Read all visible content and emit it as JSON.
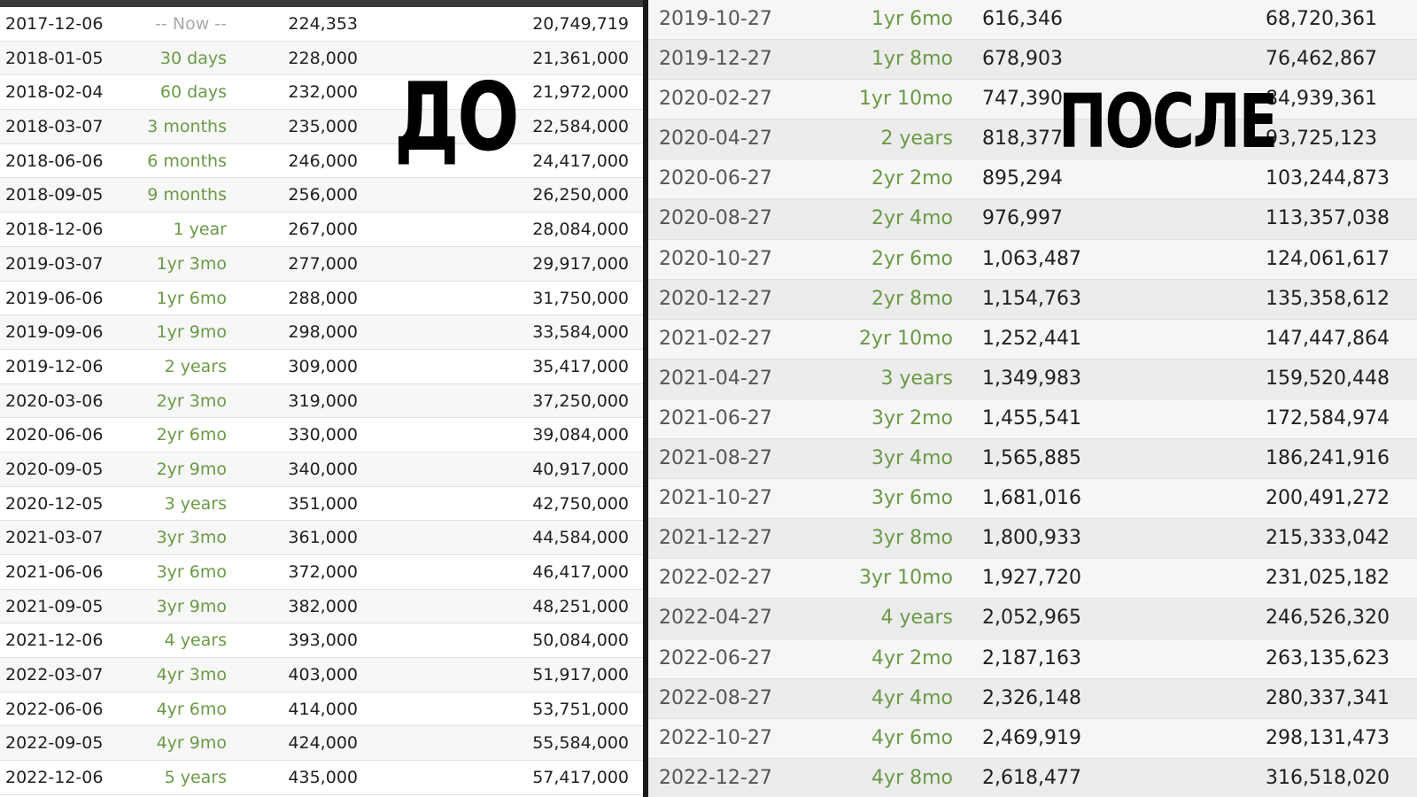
{
  "before_label": "ДО",
  "after_label": "ПОСЛЕ",
  "before_rows": [
    {
      "date": "2017-12-06",
      "period": "-- Now --",
      "daily": "224,353",
      "total": "20,749,719"
    },
    {
      "date": "2018-01-05",
      "period": "30 days",
      "daily": "228,000",
      "total": "21,361,000"
    },
    {
      "date": "2018-02-04",
      "period": "60 days",
      "daily": "232,000",
      "total": "21,972,000"
    },
    {
      "date": "2018-03-07",
      "period": "3 months",
      "daily": "235,000",
      "total": "22,584,000"
    },
    {
      "date": "2018-06-06",
      "period": "6 months",
      "daily": "246,000",
      "total": "24,417,000"
    },
    {
      "date": "2018-09-05",
      "period": "9 months",
      "daily": "256,000",
      "total": "26,250,000"
    },
    {
      "date": "2018-12-06",
      "period": "1 year",
      "daily": "267,000",
      "total": "28,084,000"
    },
    {
      "date": "2019-03-07",
      "period": "1yr 3mo",
      "daily": "277,000",
      "total": "29,917,000"
    },
    {
      "date": "2019-06-06",
      "period": "1yr 6mo",
      "daily": "288,000",
      "total": "31,750,000"
    },
    {
      "date": "2019-09-06",
      "period": "1yr 9mo",
      "daily": "298,000",
      "total": "33,584,000"
    },
    {
      "date": "2019-12-06",
      "period": "2 years",
      "daily": "309,000",
      "total": "35,417,000"
    },
    {
      "date": "2020-03-06",
      "period": "2yr 3mo",
      "daily": "319,000",
      "total": "37,250,000"
    },
    {
      "date": "2020-06-06",
      "period": "2yr 6mo",
      "daily": "330,000",
      "total": "39,084,000"
    },
    {
      "date": "2020-09-05",
      "period": "2yr 9mo",
      "daily": "340,000",
      "total": "40,917,000"
    },
    {
      "date": "2020-12-05",
      "period": "3 years",
      "daily": "351,000",
      "total": "42,750,000"
    },
    {
      "date": "2021-03-07",
      "period": "3yr 3mo",
      "daily": "361,000",
      "total": "44,584,000"
    },
    {
      "date": "2021-06-06",
      "period": "3yr 6mo",
      "daily": "372,000",
      "total": "46,417,000"
    },
    {
      "date": "2021-09-05",
      "period": "3yr 9mo",
      "daily": "382,000",
      "total": "48,251,000"
    },
    {
      "date": "2021-12-06",
      "period": "4 years",
      "daily": "393,000",
      "total": "50,084,000"
    },
    {
      "date": "2022-03-07",
      "period": "4yr 3mo",
      "daily": "403,000",
      "total": "51,917,000"
    },
    {
      "date": "2022-06-06",
      "period": "4yr 6mo",
      "daily": "414,000",
      "total": "53,751,000"
    },
    {
      "date": "2022-09-05",
      "period": "4yr 9mo",
      "daily": "424,000",
      "total": "55,584,000"
    },
    {
      "date": "2022-12-06",
      "period": "5 years",
      "daily": "435,000",
      "total": "57,417,000"
    }
  ],
  "after_rows": [
    {
      "date": "2019-10-27",
      "period": "1yr 6mo",
      "daily": "616,346",
      "total": "68,720,361"
    },
    {
      "date": "2019-12-27",
      "period": "1yr 8mo",
      "daily": "678,903",
      "total": "76,462,867"
    },
    {
      "date": "2020-02-27",
      "period": "1yr 10mo",
      "daily": "747,390",
      "total": "84,939,361"
    },
    {
      "date": "2020-04-27",
      "period": "2 years",
      "daily": "818,377",
      "total": "93,725,123"
    },
    {
      "date": "2020-06-27",
      "period": "2yr 2mo",
      "daily": "895,294",
      "total": "103,244,873"
    },
    {
      "date": "2020-08-27",
      "period": "2yr 4mo",
      "daily": "976,997",
      "total": "113,357,038"
    },
    {
      "date": "2020-10-27",
      "period": "2yr 6mo",
      "daily": "1,063,487",
      "total": "124,061,617"
    },
    {
      "date": "2020-12-27",
      "period": "2yr 8mo",
      "daily": "1,154,763",
      "total": "135,358,612"
    },
    {
      "date": "2021-02-27",
      "period": "2yr 10mo",
      "daily": "1,252,441",
      "total": "147,447,864"
    },
    {
      "date": "2021-04-27",
      "period": "3 years",
      "daily": "1,349,983",
      "total": "159,520,448"
    },
    {
      "date": "2021-06-27",
      "period": "3yr 2mo",
      "daily": "1,455,541",
      "total": "172,584,974"
    },
    {
      "date": "2021-08-27",
      "period": "3yr 4mo",
      "daily": "1,565,885",
      "total": "186,241,916"
    },
    {
      "date": "2021-10-27",
      "period": "3yr 6mo",
      "daily": "1,681,016",
      "total": "200,491,272"
    },
    {
      "date": "2021-12-27",
      "period": "3yr 8mo",
      "daily": "1,800,933",
      "total": "215,333,042"
    },
    {
      "date": "2022-02-27",
      "period": "3yr 10mo",
      "daily": "1,927,720",
      "total": "231,025,182"
    },
    {
      "date": "2022-04-27",
      "period": "4 years",
      "daily": "2,052,965",
      "total": "246,526,320"
    },
    {
      "date": "2022-06-27",
      "period": "4yr 2mo",
      "daily": "2,187,163",
      "total": "263,135,623"
    },
    {
      "date": "2022-08-27",
      "period": "4yr 4mo",
      "daily": "2,326,148",
      "total": "280,337,341"
    },
    {
      "date": "2022-10-27",
      "period": "4yr 6mo",
      "daily": "2,469,919",
      "total": "298,131,473"
    },
    {
      "date": "2022-12-27",
      "period": "4yr 8mo",
      "daily": "2,618,477",
      "total": "316,518,020"
    }
  ],
  "colors": {
    "period_green": "#6a9a45",
    "now_gray": "#a9a9a9",
    "divider": "#1a1a1a"
  }
}
